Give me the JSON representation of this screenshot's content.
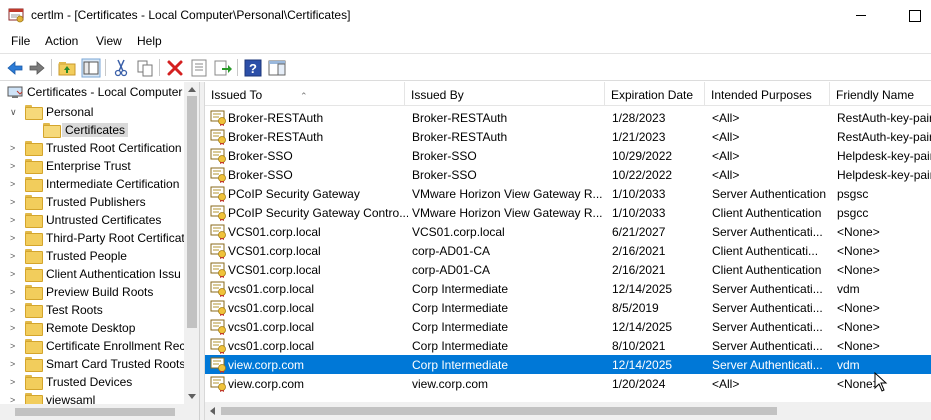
{
  "window": {
    "title": "certlm - [Certificates - Local Computer\\Personal\\Certificates]"
  },
  "menu": [
    "File",
    "Action",
    "View",
    "Help"
  ],
  "toolbar": {
    "icons": [
      "back-arrow-icon",
      "forward-arrow-icon",
      "up-folder-icon",
      "show-hide-console-tree-icon",
      "cut-icon",
      "copy-icon",
      "delete-icon",
      "properties-icon",
      "export-list-icon",
      "help-icon",
      "show-action-pane-icon"
    ]
  },
  "tree": {
    "root": "Certificates - Local Computer",
    "items": [
      {
        "label": "Personal",
        "expanded": true
      },
      {
        "label": "Certificates",
        "selected": true
      },
      {
        "label": "Trusted Root Certification"
      },
      {
        "label": "Enterprise Trust"
      },
      {
        "label": "Intermediate Certification"
      },
      {
        "label": "Trusted Publishers"
      },
      {
        "label": "Untrusted Certificates"
      },
      {
        "label": "Third-Party Root Certificat"
      },
      {
        "label": "Trusted People"
      },
      {
        "label": "Client Authentication Issu"
      },
      {
        "label": "Preview Build Roots"
      },
      {
        "label": "Test Roots"
      },
      {
        "label": "Remote Desktop"
      },
      {
        "label": "Certificate Enrollment Rec"
      },
      {
        "label": "Smart Card Trusted Roots"
      },
      {
        "label": "Trusted Devices"
      },
      {
        "label": "viewsaml"
      }
    ]
  },
  "list": {
    "columns": [
      "Issued To",
      "Issued By",
      "Expiration Date",
      "Intended Purposes",
      "Friendly Name"
    ],
    "rows": [
      [
        "Broker-RESTAuth",
        "Broker-RESTAuth",
        "1/28/2023",
        "<All>",
        "RestAuth-key-pair"
      ],
      [
        "Broker-RESTAuth",
        "Broker-RESTAuth",
        "1/21/2023",
        "<All>",
        "RestAuth-key-pair"
      ],
      [
        "Broker-SSO",
        "Broker-SSO",
        "10/29/2022",
        "<All>",
        "Helpdesk-key-pair"
      ],
      [
        "Broker-SSO",
        "Broker-SSO",
        "10/22/2022",
        "<All>",
        "Helpdesk-key-pair"
      ],
      [
        "PCoIP Security Gateway",
        "VMware Horizon View Gateway R...",
        "1/10/2033",
        "Server Authentication",
        "psgsc"
      ],
      [
        "PCoIP Security Gateway Contro...",
        "VMware Horizon View Gateway R...",
        "1/10/2033",
        "Client Authentication",
        "psgcc"
      ],
      [
        "VCS01.corp.local",
        "VCS01.corp.local",
        "6/21/2027",
        "Server Authenticati...",
        "<None>"
      ],
      [
        "VCS01.corp.local",
        "corp-AD01-CA",
        "2/16/2021",
        "Client Authenticati...",
        "<None>"
      ],
      [
        "VCS01.corp.local",
        "corp-AD01-CA",
        "2/16/2021",
        "Client Authentication",
        "<None>"
      ],
      [
        "vcs01.corp.local",
        "Corp Intermediate",
        "12/14/2025",
        "Server Authenticati...",
        "vdm"
      ],
      [
        "vcs01.corp.local",
        "Corp Intermediate",
        "8/5/2019",
        "Server Authenticati...",
        "<None>"
      ],
      [
        "vcs01.corp.local",
        "Corp Intermediate",
        "12/14/2025",
        "Server Authenticati...",
        "<None>"
      ],
      [
        "vcs01.corp.local",
        "Corp Intermediate",
        "8/10/2021",
        "Server Authenticati...",
        "<None>"
      ],
      [
        "view.corp.com",
        "Corp Intermediate",
        "12/14/2025",
        "Server Authenticati...",
        "vdm"
      ],
      [
        "view.corp.com",
        "view.corp.com",
        "1/20/2024",
        "<All>",
        "<None>"
      ]
    ],
    "selected_row": 13
  },
  "colors": {
    "selection": "#0078d7",
    "tree_selection": "#d9d9d9"
  }
}
